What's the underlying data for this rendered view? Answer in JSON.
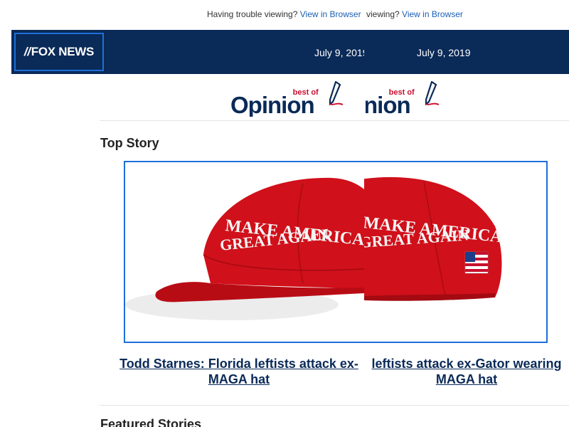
{
  "topbar": {
    "prefix_full": "Having trouble viewing?",
    "prefix_cut": "viewing?",
    "link_label": "View in Browser"
  },
  "header": {
    "logo_text": "FOX NEWS",
    "date": "July 9, 2019"
  },
  "opinion_banner": {
    "best_of": "best of",
    "word": "Opinion"
  },
  "sections": {
    "top_story": "Top Story",
    "featured": "Featured Stories"
  },
  "top_story": {
    "image_text_line1": "MAKE AMERICA",
    "image_text_line2": "GREAT AGAIN",
    "headline_left_line1": "Todd Starnes: Florida leftists attack ex-",
    "headline_left_line2": "MAGA hat",
    "headline_right_line1": "leftists attack ex-Gator wearing",
    "headline_right_line2": "MAGA hat"
  },
  "colors": {
    "navy": "#0a2a58",
    "link_blue": "#1a5fb4",
    "frame_blue": "#1e6fd9",
    "hat_red": "#d0101a",
    "opinion_red": "#c8102e"
  }
}
